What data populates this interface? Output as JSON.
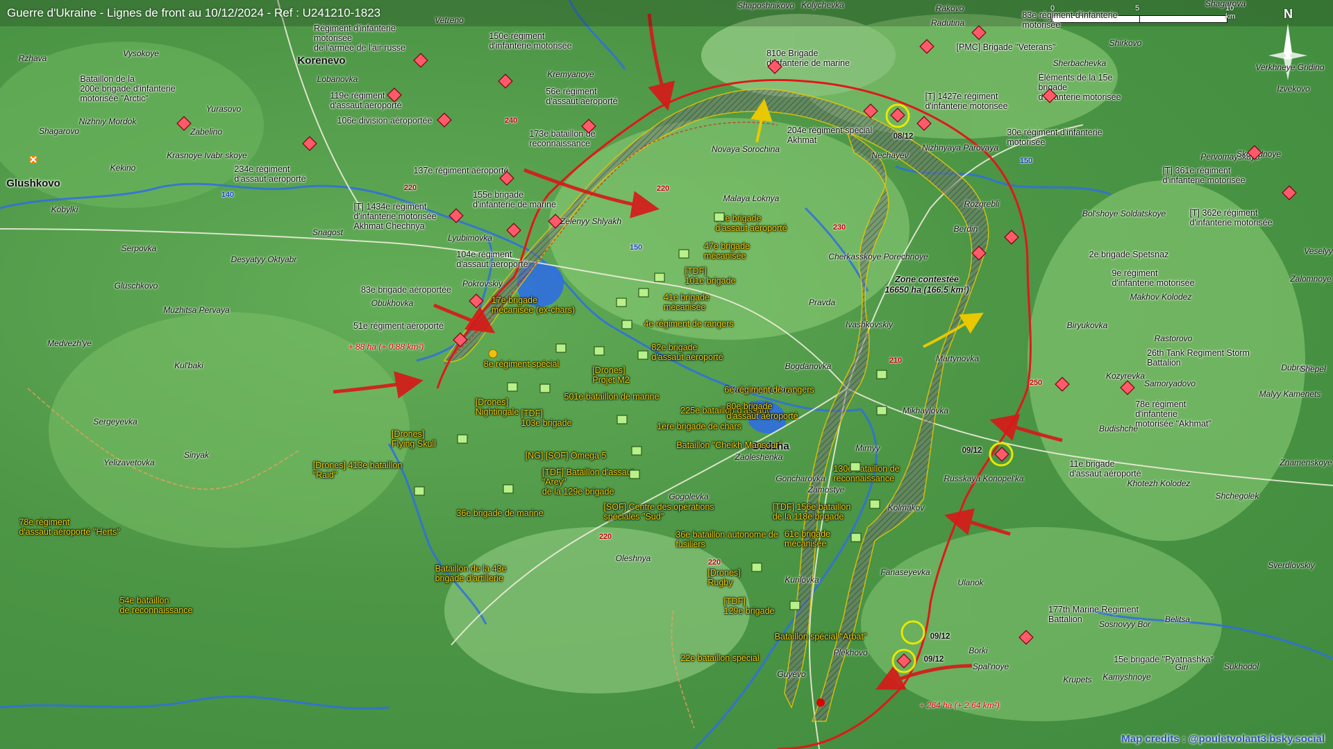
{
  "title": "Guerre d'Ukraine - Lignes de front au 10/12/2024 - Ref : U241210-1823",
  "scale": {
    "labels": [
      "0",
      "5",
      "10 km"
    ]
  },
  "north_label": "N",
  "credits": "Map credits : @pouletvolant3.bsky.social",
  "colors": {
    "front_line": "#e01818",
    "contested": "#7a7a7a",
    "russian_unit": "#ff5a6a",
    "ukrainian_unit": "#b8f08a",
    "ua_text": "#f0d010",
    "river": "#2f6fe0"
  },
  "zone": {
    "line1": "Zone contestée",
    "line2": "16650 ha (166.5 km²)"
  },
  "gains": [
    "+ 88 ha (+ 0.88 km²)",
    "+ 264 ha (+ 2.64 km²)"
  ],
  "dates": [
    "08/12",
    "09/12",
    "09/12",
    "09/12"
  ],
  "roads": [
    "240",
    "220",
    "220",
    "230",
    "150",
    "140",
    "210",
    "250",
    "150",
    "220",
    "220"
  ],
  "towns": [
    "Kolychevka",
    "Vetreno",
    "Shaposhnikovo",
    "Rakovo",
    "Radutina",
    "Shagarova",
    "Rzhava",
    "Vysokoye",
    "Korenevo",
    "Lobanovka",
    "Kremyanoye",
    "Yurasovo",
    "Nizhniy Mordok",
    "Zabelino",
    "Shagarovo",
    "Krasnoye Ivabr skoye",
    "Kekino",
    "Glushkovo",
    "Kobylki",
    "Snagost",
    "Lyubimovka",
    "Zelenyy Shlyakh",
    "Malaya Loknya",
    "Novaya Sorochina",
    "Nechayev",
    "Nizhnyaya Parovaya",
    "Sherbachevka",
    "Shirkovo",
    "Verkhneye Gridino",
    "Izvekovo",
    "Pervomayskaya",
    "Skorodnoye",
    "Rozgrebli",
    "Bol'shoye Soldatskoye",
    "Berdin",
    "Veselyy",
    "Zalomnoye",
    "Makhov Kolodez",
    "Rastorovo",
    "Biryukovka",
    "Kozyrevka",
    "Samoryadovo",
    "Dubrava",
    "Shepel",
    "Malyy Kamenets",
    "Budishche",
    "Znamenskoye",
    "Khotezh Kolodez",
    "Shchegolek",
    "Sverdlovskiy",
    "Serpovka",
    "Desyatyy Oktyabr",
    "Gluschkovo",
    "Muzhitsa Pervaya",
    "Pokrovskiy",
    "Obukhovka",
    "Medvezh'ye",
    "Kul'baki",
    "Sergeyevka",
    "Sinyak",
    "Yelizavetovka",
    "Cherkasskoye Porechnoye",
    "Pravda",
    "Ivashkovskiy",
    "Martynovka",
    "Bogdanovka",
    "Kazach'ya Loknya",
    "Mikhaylovka",
    "Sudzha",
    "Mirnyy",
    "Zaoleshenka",
    "Goncharovka",
    "Zamostye",
    "Kolmakov",
    "Russkaya Konopel'ka",
    "Gogolevka",
    "Oleshnya",
    "Kurilovka",
    "Fanaseyevka",
    "Ulanok",
    "Plekhovo",
    "Borki",
    "Spal'noye",
    "Guyevo",
    "Sosnovyy Bor",
    "Belitsa",
    "Krupets",
    "Kamyshnoye",
    "Sukhodol",
    "Giri"
  ],
  "russian_units": [
    "Régiment d'infanterie\nmotorisée\nde l'armée de l'air russe",
    "150e régiment\nd'infanterie motorisée",
    "Bataillon de la\n200e brigade d'infanterie\nmotorisée \"Arctic\"",
    "119e régiment\nd'assaut aéroporté",
    "56e régiment\nd'assaut aéroporté",
    "106e division aéroportée",
    "173e bataillon de\nreconnaissance",
    "234e régiment\nd'assaut aéroporté",
    "137e régiment aéroporté",
    "155e brigade\nd'infanterie de marine",
    "[T] 1434e régiment\nd'infanterie motorisée\nAkhmat Chechnya",
    "104e régiment\nd'assaut aéroporté",
    "83e brigade aéroportée",
    "51e régiment aéroporté",
    "810e Brigade\nd'infanterie de marine",
    "204e régiment spécial\nAkhmat",
    "[T] 1427e régiment\nd'infanterie motorisée",
    "83e régiment d'infanterie\nmotorisée",
    "[PMC] Brigade \"Veterans\"",
    "Éléments de la 15e\nbrigade\nd'infanterie motorisée",
    "30e régiment d'infanterie\nmotorisée",
    "[T] 361e régiment\nd'infanterie motorisée",
    "[T] 362e régiment\nd'infanterie motorisée",
    "2e brigade Spetsnaz",
    "9e régiment\nd'infanterie motorisée",
    "26th Tank Regiment Storm\nBattalion",
    "78e régiment\nd'infanterie\nmotorisée \"Akhmat\"",
    "11e brigade\nd'assaut aéroporté",
    "177th Marine Regiment\nBattalion",
    "15e brigade \"Pyatnashka\""
  ],
  "ukrainian_units": [
    "95e brigade\nd'assaut aéroporté",
    "47e brigade\nmécanisée",
    "[TDF]\n101e brigade",
    "17e brigade\nmécanisée (ex-chars)",
    "41e brigade\nmécanisée",
    "4e régiment de rangers",
    "82e brigade\nd'assaut aéroporté",
    "8e régiment spécial",
    "[Drones]\nProjet M2",
    "501e bataillon de marine",
    "[Drones]\nNightingale",
    "[TDF]\n103e brigade",
    "225e bataillon d'assaut",
    "1ère brigade de chars",
    "[Drones]\nFlying Skull",
    "[NG] [SOF] Omega 5",
    "Bataillon \"Cheikh Mansour\"",
    "6e régiment de rangers",
    "80e brigade\nd'assaut aéroporté",
    "[Drones] 413e bataillon\n\"Raid\"",
    "[TDF] Bataillon d'assaut\n\"Arey\"\nde la 129e brigade",
    "130e bataillon de\nreconnaissance",
    "78e régiment\nd'assaut aéroporté \"Herts\"",
    "36e brigade de marine",
    "[SOF] Centre des opérations\nspéciales \"Sud\"",
    "[TDF] 156e bataillon\nde la 118e brigade",
    "36e bataillon autonome de\nfusiliers",
    "61e brigade\nmécanisée",
    "Bataillon de la 43e\nbrigade d'artillerie",
    "[Drones]\nRugby",
    "54e bataillon\nde reconnaissance",
    "[TDF]\n129e brigade",
    "Bataillon spécial \"Arbat\"",
    "22e bataillon spécial"
  ]
}
